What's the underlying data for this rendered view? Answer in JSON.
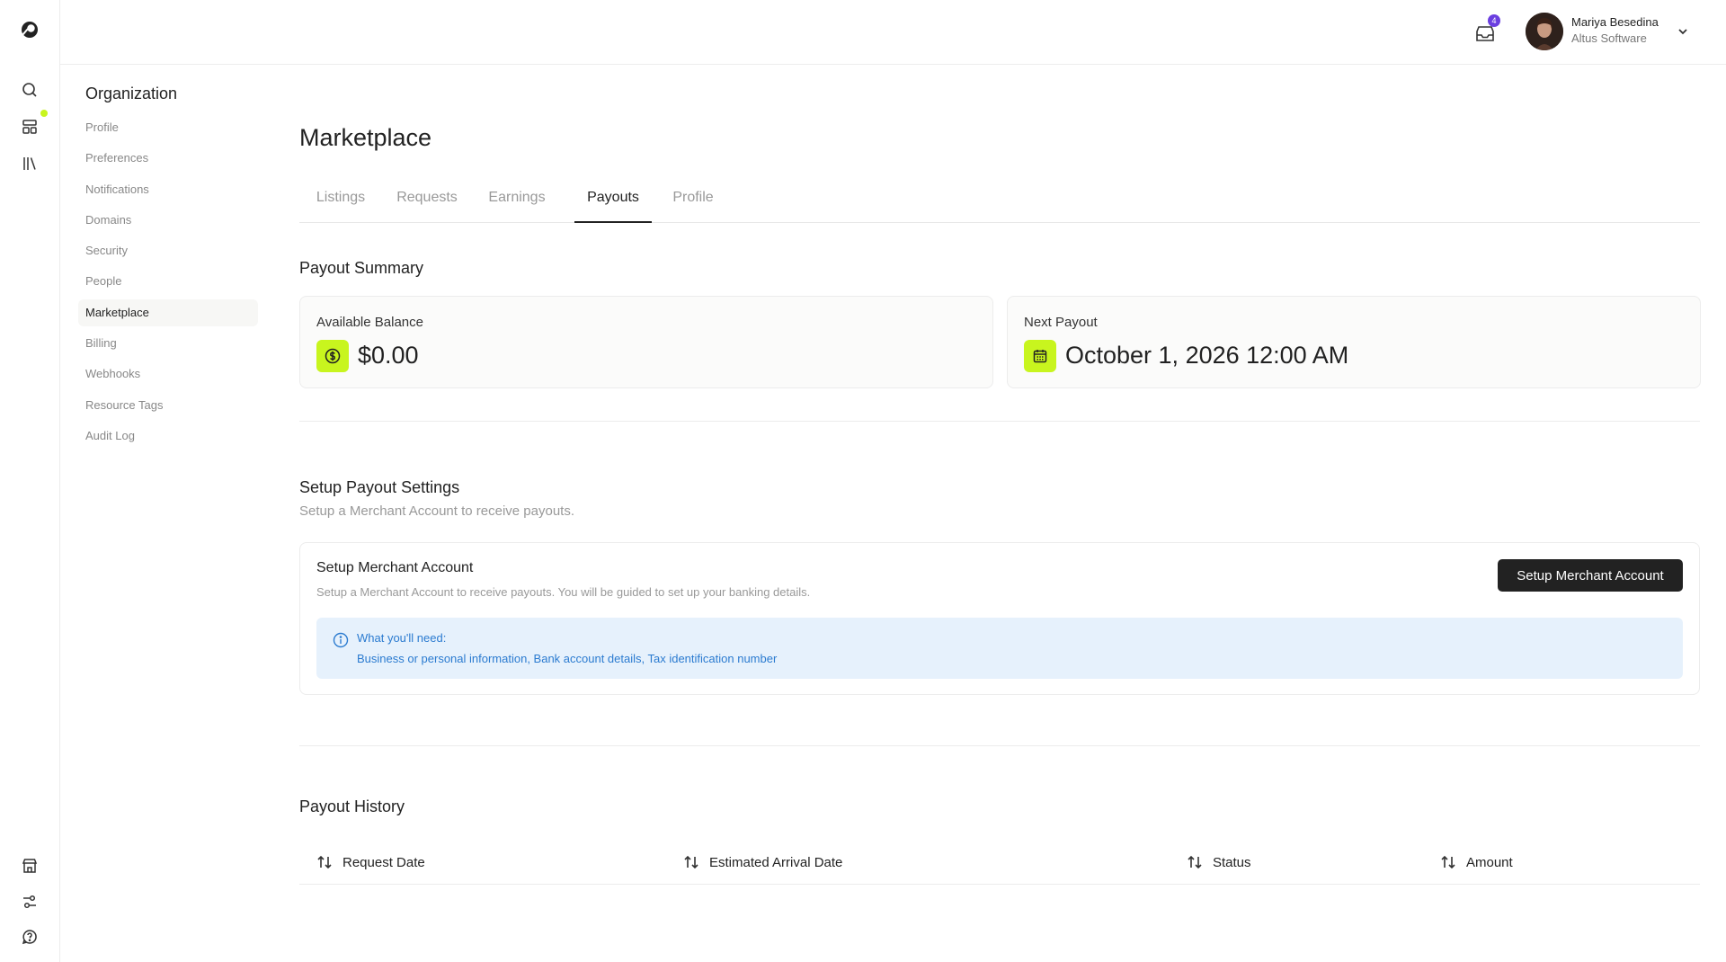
{
  "header": {
    "inbox_count": "4",
    "user_name": "Mariya Besedina",
    "user_org": "Altus Software"
  },
  "rail": {
    "icons": [
      "app-logo-icon",
      "search-icon",
      "dashboard-icon",
      "library-icon",
      "store-icon",
      "settings-sliders-icon",
      "help-icon"
    ]
  },
  "sidebar": {
    "title": "Organization",
    "items": [
      {
        "label": "Profile"
      },
      {
        "label": "Preferences"
      },
      {
        "label": "Notifications"
      },
      {
        "label": "Domains"
      },
      {
        "label": "Security"
      },
      {
        "label": "People"
      },
      {
        "label": "Marketplace",
        "active": true
      },
      {
        "label": "Billing"
      },
      {
        "label": "Webhooks"
      },
      {
        "label": "Resource Tags"
      },
      {
        "label": "Audit Log"
      }
    ]
  },
  "main": {
    "title": "Marketplace",
    "tabs": [
      {
        "label": "Listings"
      },
      {
        "label": "Requests"
      },
      {
        "label": "Earnings"
      },
      {
        "label": "Payouts",
        "active": true
      },
      {
        "label": "Profile"
      }
    ],
    "payout_summary": {
      "title": "Payout Summary",
      "available_balance_label": "Available Balance",
      "available_balance_value": "$0.00",
      "next_payout_label": "Next Payout",
      "next_payout_value": "October 1, 2026 12:00 AM"
    },
    "setup": {
      "title": "Setup Payout Settings",
      "subtitle": "Setup a Merchant Account to receive payouts.",
      "card_title": "Setup Merchant Account",
      "card_subtitle": "Setup a Merchant Account to receive payouts. You will be guided to set up your banking details.",
      "button_label": "Setup Merchant Account",
      "info_title": "What you'll need:",
      "info_body": "Business or personal information, Bank account details, Tax identification number"
    },
    "history": {
      "title": "Payout History",
      "columns": [
        {
          "label": "Request Date"
        },
        {
          "label": "Estimated Arrival Date"
        },
        {
          "label": "Status"
        },
        {
          "label": "Amount"
        }
      ]
    }
  },
  "colors": {
    "accent": "#c8f51e",
    "badge": "#6b3fe0",
    "info_bg": "#e6f1fc",
    "info_text": "#2b7bd0",
    "primary_button": "#222222"
  }
}
